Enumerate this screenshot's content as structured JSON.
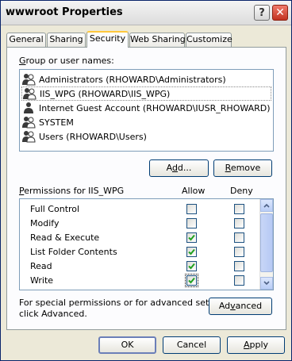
{
  "window": {
    "title": "wwwroot Properties",
    "help_symbol": "?",
    "close_symbol": "✕"
  },
  "tabs": [
    {
      "label": "General"
    },
    {
      "label": "Sharing"
    },
    {
      "label": "Security",
      "active": true
    },
    {
      "label": "Web Sharing"
    },
    {
      "label": "Customize"
    }
  ],
  "group_section": {
    "label_prefix": "",
    "label_mnemonic": "G",
    "label_rest": "roup or user names:",
    "users": [
      {
        "name": "Administrators (RHOWARD\\Administrators)",
        "icon": "user-group-icon"
      },
      {
        "name": "IIS_WPG (RHOWARD\\IIS_WPG)",
        "icon": "user-group-icon",
        "selected": true
      },
      {
        "name": "Internet Guest Account (RHOWARD\\IUSR_RHOWARD)",
        "icon": "user-icon"
      },
      {
        "name": "SYSTEM",
        "icon": "user-group-icon"
      },
      {
        "name": "Users (RHOWARD\\Users)",
        "icon": "user-group-icon"
      }
    ],
    "add_button": {
      "pre": "A",
      "mn": "d",
      "post": "d..."
    },
    "remove_button": {
      "pre": "",
      "mn": "R",
      "post": "emove"
    }
  },
  "permissions": {
    "label_mnemonic": "P",
    "label_rest": "ermissions for IIS_WPG",
    "allow_header": "Allow",
    "deny_header": "Deny",
    "rows": [
      {
        "name": "Full Control",
        "allow": false,
        "deny": false
      },
      {
        "name": "Modify",
        "allow": false,
        "deny": false
      },
      {
        "name": "Read & Execute",
        "allow": true,
        "deny": false
      },
      {
        "name": "List Folder Contents",
        "allow": true,
        "deny": false
      },
      {
        "name": "Read",
        "allow": true,
        "deny": false
      },
      {
        "name": "Write",
        "allow": true,
        "deny": false,
        "focused": true
      }
    ]
  },
  "advanced": {
    "text_line1": "For special permissions or for advanced settings,",
    "text_line2": "click Advanced.",
    "button": {
      "pre": "Ad",
      "mn": "v",
      "post": "anced"
    }
  },
  "footer": {
    "ok": "OK",
    "cancel": "Cancel",
    "apply": {
      "pre": "",
      "mn": "A",
      "post": "pply"
    }
  },
  "colors": {
    "check": "#21a121",
    "title_active_border": "#ffc83c"
  }
}
